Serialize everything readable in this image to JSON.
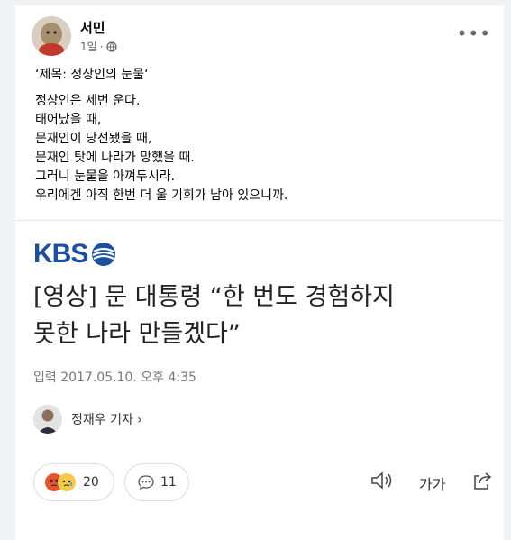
{
  "post": {
    "author": "서민",
    "time": "1일",
    "separator": "·",
    "more_label": "•••",
    "title_line": "‘제목: 정상인의 눈물‘",
    "lines": [
      "정상인은 세번 운다.",
      "태어났을 때,",
      "문재인이 당선됐을 때,",
      "문재인 탓에 나라가 망했을 때.",
      "그러니 눈물을 아껴두시라.",
      "우리에겐 아직 한번 더 울 기회가 남아 있으니까."
    ]
  },
  "article": {
    "source_logo": "KBS",
    "headline_line1": "[영상] 문 대통령 “한 번도 경험하지",
    "headline_line2": "못한 나라 만들겠다”",
    "date": "입력 2017.05.10. 오후 4:35",
    "reporter": "정재우 기자 ›"
  },
  "actions": {
    "reaction_count": "20",
    "comment_count": "11",
    "font_size_label": "가가"
  },
  "colors": {
    "kbs_blue": "#1b4fa0",
    "angry": "#e8532c",
    "sad": "#f7c948"
  }
}
